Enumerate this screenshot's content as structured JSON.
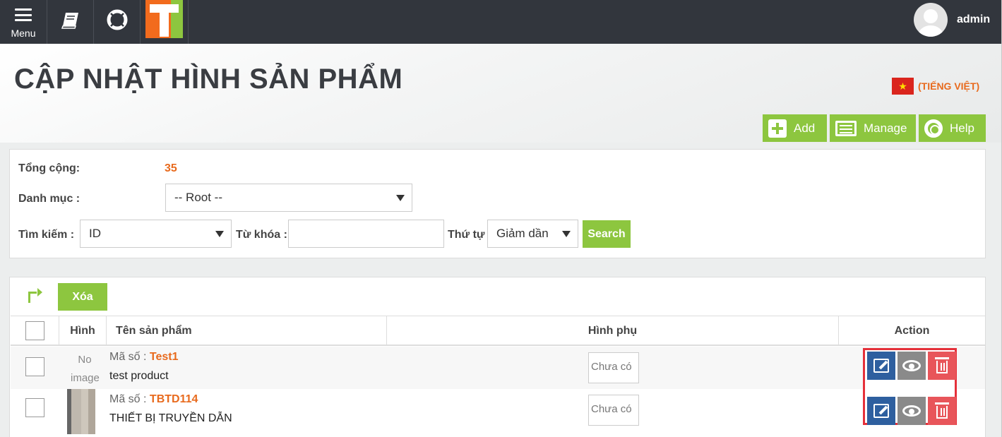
{
  "topbar": {
    "menu_label": "Menu",
    "username": "admin"
  },
  "page": {
    "title": "CẬP NHẬT HÌNH SẢN PHẨM",
    "language": "(TIẾNG VIỆT)"
  },
  "actions": {
    "add": "Add",
    "manage": "Manage",
    "help": "Help"
  },
  "filter": {
    "total_label": "Tổng cộng:",
    "total_value": "35",
    "category_label": "Danh mục :",
    "category_value": "-- Root --",
    "search_label": "Tìm kiếm :",
    "search_field_value": "ID",
    "keyword_label": "Từ khóa :",
    "keyword_value": "",
    "order_label": "Thứ tự",
    "order_value": "Giảm dần",
    "search_button": "Search"
  },
  "list": {
    "delete_button": "Xóa",
    "columns": {
      "image": "Hình",
      "product_name": "Tên sản phẩm",
      "sub_image": "Hình phụ",
      "action": "Action"
    },
    "code_prefix": "Mã số :",
    "rows": [
      {
        "image_text": "No image",
        "code": "Test1",
        "name": "test product",
        "sub_image": "Chưa có"
      },
      {
        "image_text": "",
        "code": "TBTD114",
        "name": "THIẾT BỊ TRUYỀN DẪN",
        "sub_image": "Chưa có"
      }
    ]
  },
  "colors": {
    "topbar": "#32363d",
    "accent_green": "#8dc63f",
    "accent_orange": "#e86a1d",
    "edit_blue": "#2e5f9f",
    "view_gray": "#8a8a8a",
    "delete_red": "#e8555a"
  }
}
